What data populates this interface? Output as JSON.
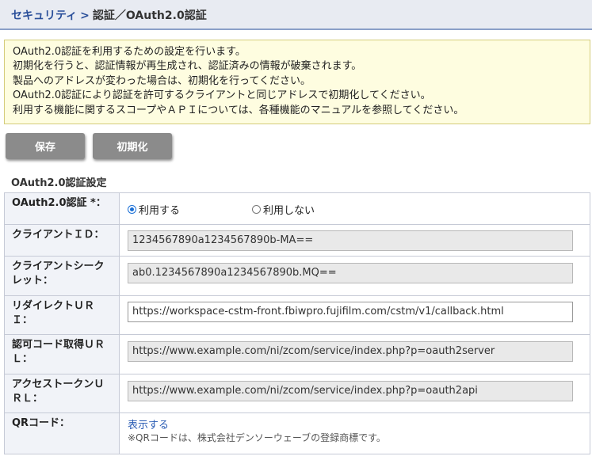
{
  "breadcrumb": {
    "parent": "セキュリティ",
    "separator": ">",
    "current": "認証／OAuth2.0認証"
  },
  "notice": {
    "lines": [
      "OAuth2.0認証を利用するための設定を行います。",
      "初期化を行うと、認証情報が再生成され、認証済みの情報が破棄されます。",
      "製品へのアドレスが変わった場合は、初期化を行ってください。",
      "OAuth2.0認証により認証を許可するクライアントと同じアドレスで初期化してください。",
      "利用する機能に関するスコープやＡＰＩについては、各種機能のマニュアルを参照してください。"
    ]
  },
  "buttons": {
    "save": "保存",
    "reset": "初期化"
  },
  "section_title": "OAuth2.0認証設定",
  "form": {
    "oauth": {
      "label": "OAuth2.0認証 *：",
      "option_use": "利用する",
      "option_not_use": "利用しない",
      "selected": "利用する"
    },
    "client_id": {
      "label": "クライアントＩＤ：",
      "value": "1234567890a1234567890b-MA=="
    },
    "client_secret": {
      "label_line1": "クライアントシーク",
      "label_line2": "レット：",
      "value": "ab0.1234567890a1234567890b.MQ=="
    },
    "redirect_uri": {
      "label_line1": "リダイレクトＵＲ",
      "label_line2": "Ｉ：",
      "value": "https://workspace-cstm-front.fbiwpro.fujifilm.com/cstm/v1/callback.html"
    },
    "auth_code_url": {
      "label_line1": "認可コード取得ＵＲ",
      "label_line2": "Ｌ：",
      "value": "https://www.example.com/ni/zcom/service/index.php?p=oauth2server"
    },
    "access_token_url": {
      "label_line1": "アクセストークンＵ",
      "label_line2": "ＲＬ：",
      "value": "https://www.example.com/ni/zcom/service/index.php?p=oauth2api"
    },
    "qr": {
      "label": "QRコード：",
      "link": "表示する",
      "note": "※QRコードは、株式会社デンソーウェーブの登録商標です。"
    }
  },
  "colors": {
    "header_bg": "#e8ebf2",
    "link": "#2a4f9a",
    "notice_bg": "#fefde0",
    "button_bg": "#8b8b8b",
    "radio_accent": "#1a6fd6"
  }
}
